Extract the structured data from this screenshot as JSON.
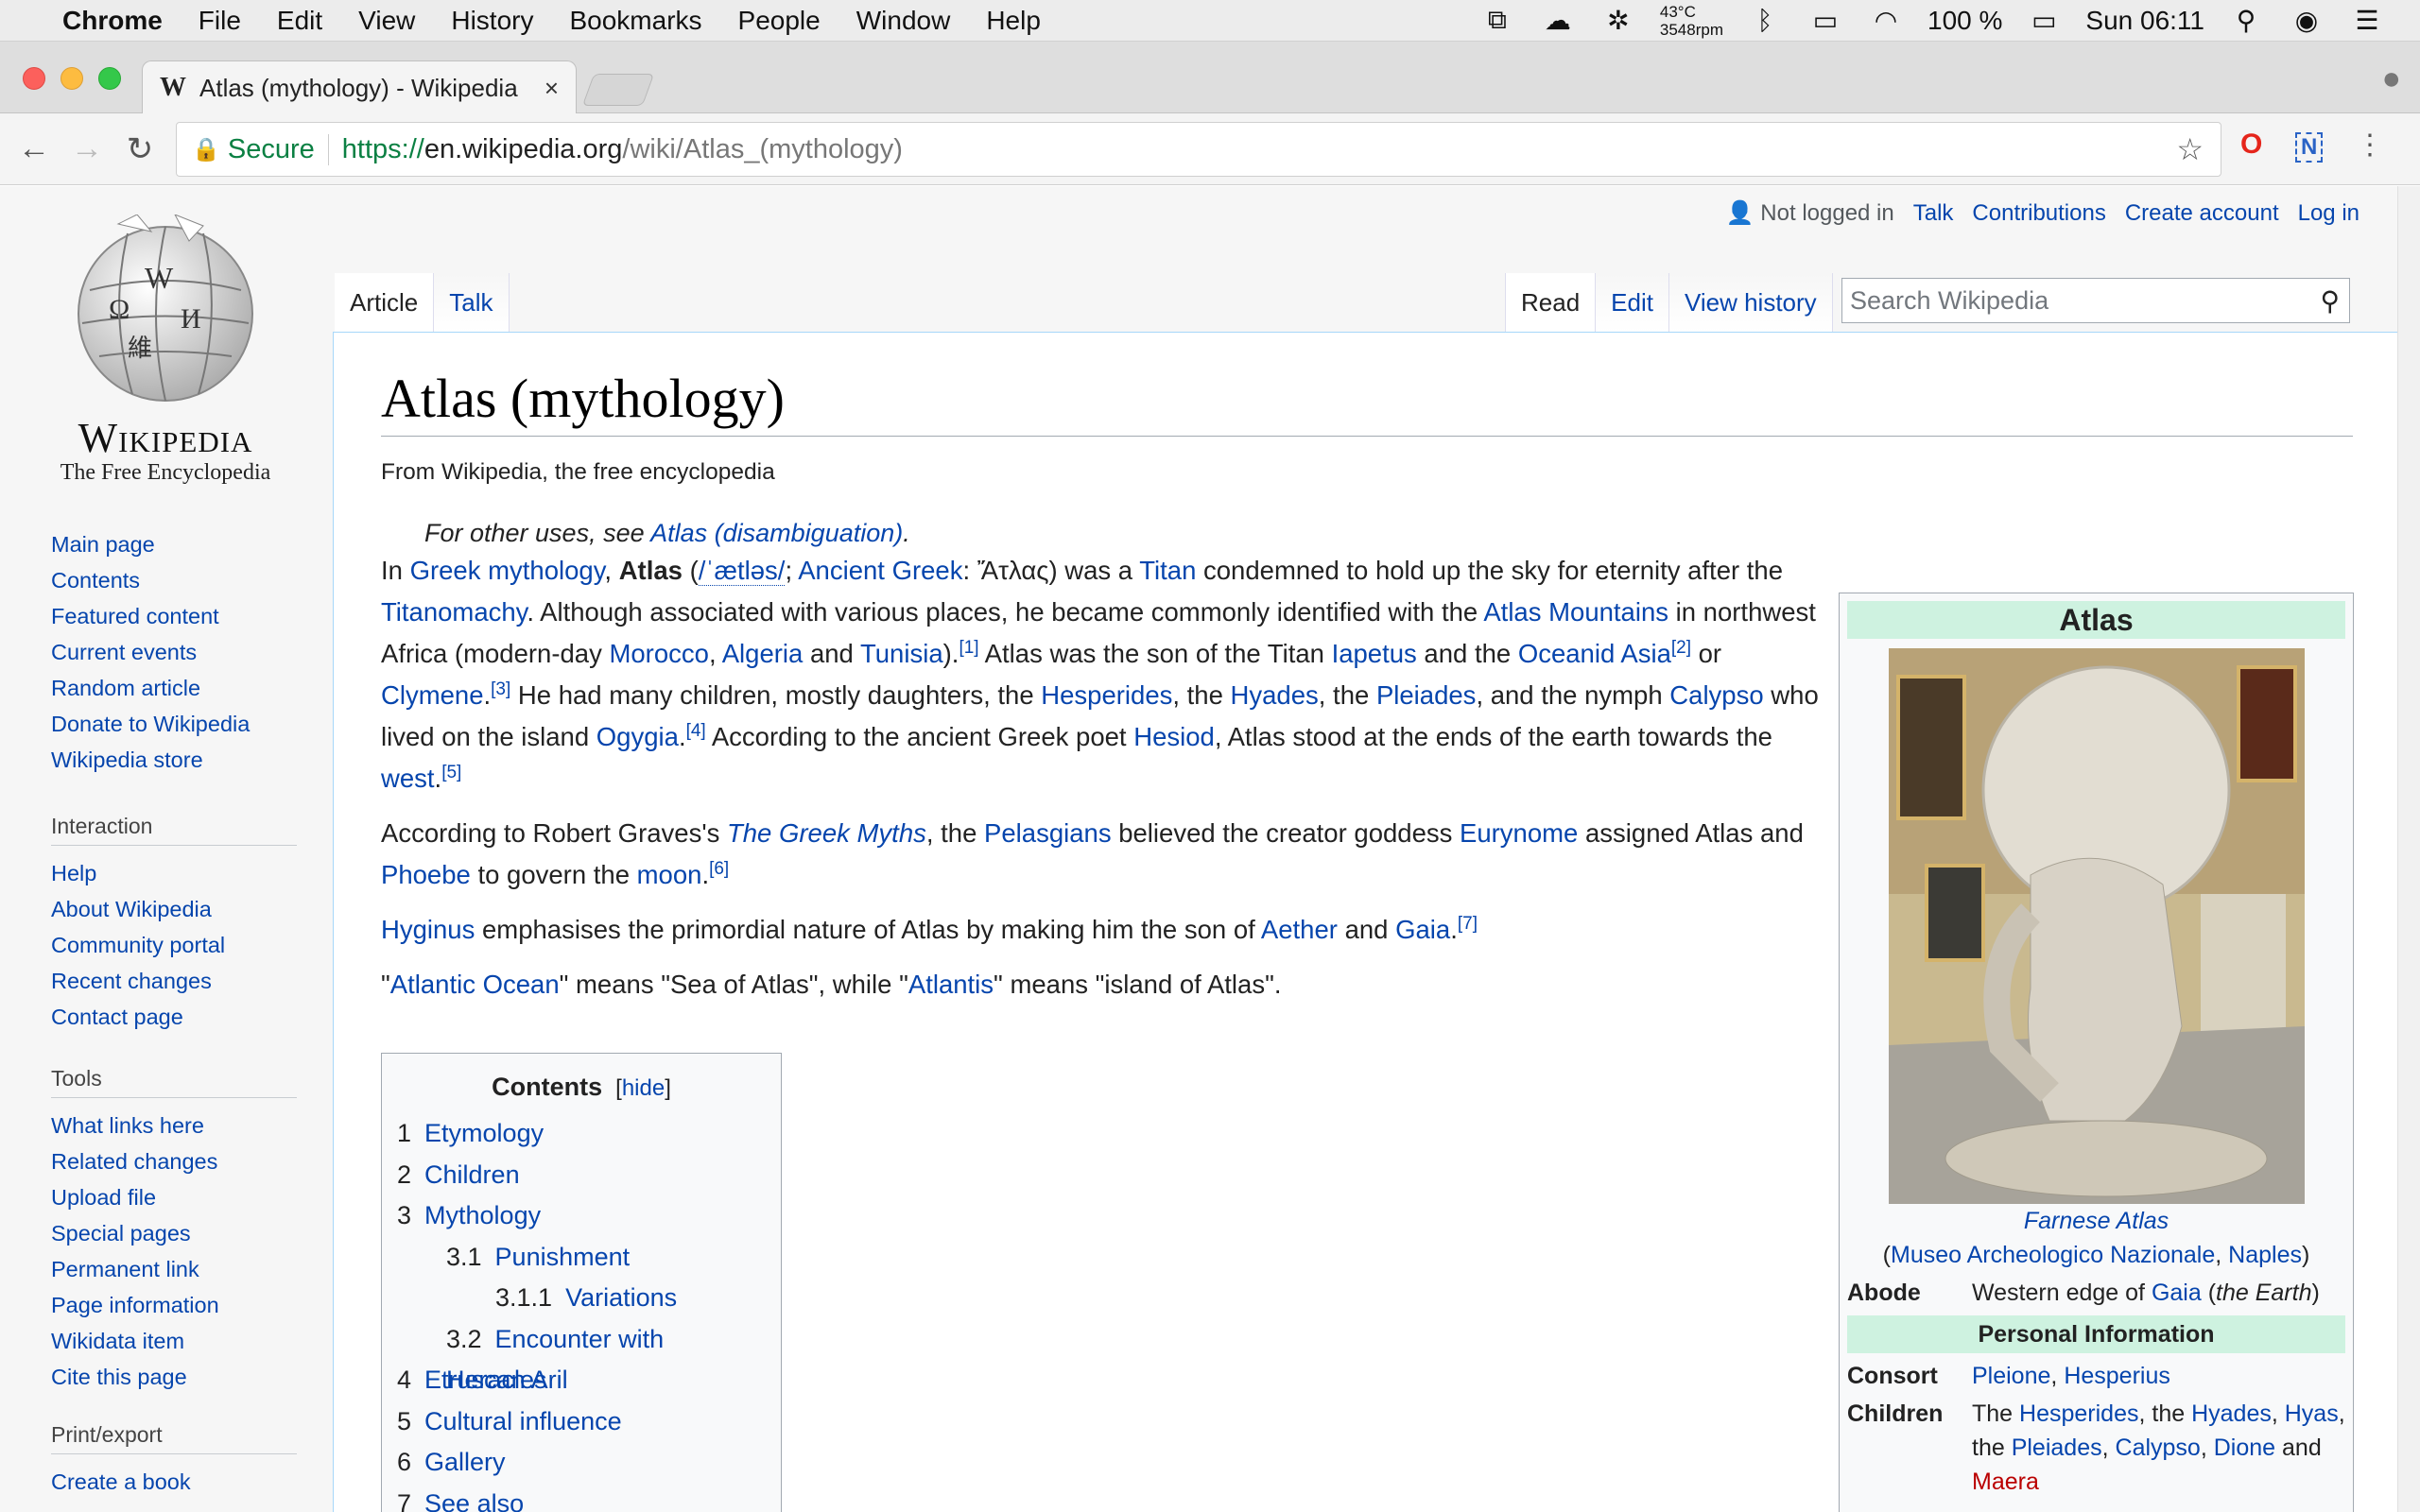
{
  "menubar": {
    "app": "Chrome",
    "items": [
      "File",
      "Edit",
      "View",
      "History",
      "Bookmarks",
      "People",
      "Window",
      "Help"
    ],
    "temp": "43°C",
    "rpm": "3548rpm",
    "battery": "100 %",
    "clock": "Sun 06:11"
  },
  "browser": {
    "tab_title": "Atlas (mythology) - Wikipedia",
    "tab_close": "×",
    "secure_label": "Secure",
    "url_scheme": "https://",
    "url_host": "en.wikipedia.org",
    "url_path": "/wiki/Atlas_(mythology)"
  },
  "personal": {
    "not_logged_in": "Not logged in",
    "talk": "Talk",
    "contributions": "Contributions",
    "create_account": "Create account",
    "log_in": "Log in"
  },
  "logo": {
    "wordmark": "Wikipedia",
    "tagline": "The Free Encyclopedia"
  },
  "nav": {
    "main": [
      "Main page",
      "Contents",
      "Featured content",
      "Current events",
      "Random article",
      "Donate to Wikipedia",
      "Wikipedia store"
    ],
    "interaction_head": "Interaction",
    "interaction": [
      "Help",
      "About Wikipedia",
      "Community portal",
      "Recent changes",
      "Contact page"
    ],
    "tools_head": "Tools",
    "tools": [
      "What links here",
      "Related changes",
      "Upload file",
      "Special pages",
      "Permanent link",
      "Page information",
      "Wikidata item",
      "Cite this page"
    ],
    "print_head": "Print/export",
    "print": [
      "Create a book"
    ]
  },
  "tabs": {
    "article": "Article",
    "talk": "Talk",
    "read": "Read",
    "edit": "Edit",
    "history": "View history",
    "search_placeholder": "Search Wikipedia"
  },
  "article": {
    "title": "Atlas (mythology)",
    "site_sub": "From Wikipedia, the free encyclopedia",
    "hatnote_prefix": "For other uses, see ",
    "hatnote_link": "Atlas (disambiguation)",
    "hatnote_suffix": "."
  },
  "toc": {
    "title": "Contents",
    "hide": "hide",
    "items": [
      {
        "num": "1",
        "text": "Etymology",
        "level": 1
      },
      {
        "num": "2",
        "text": "Children",
        "level": 1
      },
      {
        "num": "3",
        "text": "Mythology",
        "level": 1
      },
      {
        "num": "3.1",
        "text": "Punishment",
        "level": 2
      },
      {
        "num": "3.1.1",
        "text": "Variations",
        "level": 3
      },
      {
        "num": "3.2",
        "text": "Encounter with Heracles",
        "level": 2
      },
      {
        "num": "4",
        "text": "Etruscan Aril",
        "level": 1
      },
      {
        "num": "5",
        "text": "Cultural influence",
        "level": 1
      },
      {
        "num": "6",
        "text": "Gallery",
        "level": 1
      },
      {
        "num": "7",
        "text": "See also",
        "level": 1
      }
    ]
  },
  "infobox": {
    "title": "Atlas",
    "caption_link": "Farnese Atlas",
    "caption_museum": "Museo Archeologico Nazionale",
    "caption_city": "Naples",
    "abode_label": "Abode",
    "abode_text": "Western edge of ",
    "abode_link": "Gaia",
    "abode_note": "the Earth",
    "section": "Personal Information",
    "consort_label": "Consort",
    "consort_1": "Pleione",
    "consort_2": "Hesperius",
    "children_label": "Children",
    "children_the": "The ",
    "child_hesperides": "Hesperides",
    "children_sep1": ", the ",
    "child_hyades": "Hyades",
    "child_hyas": "Hyas",
    "child_pleiades": "Pleiades",
    "child_calypso": "Calypso",
    "child_dione": "Dione",
    "children_and": " and ",
    "child_maera": "Maera"
  }
}
